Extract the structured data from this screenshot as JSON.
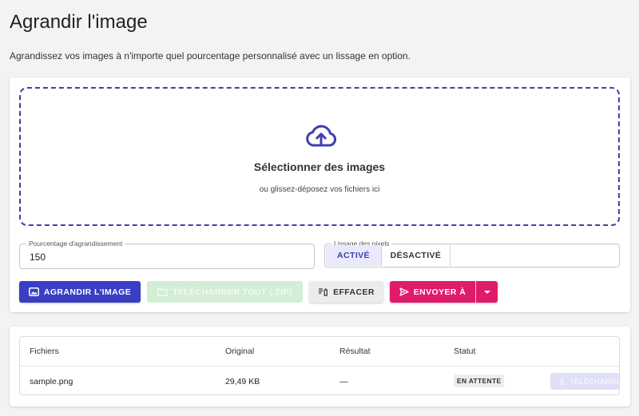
{
  "page": {
    "title": "Agrandir l'image",
    "subtitle": "Agrandissez vos images à n'importe quel pourcentage personnalisé avec un lissage en option."
  },
  "dropzone": {
    "icon": "cloud-upload-icon",
    "title": "Sélectionner des images",
    "subtitle": "ou glissez-déposez vos fichiers ici"
  },
  "options": {
    "percent_label": "Pourcentage d'agrandissement",
    "percent_value": "150",
    "smoothing_label": "Lissage des pixels",
    "smoothing_on": "ACTIVÉ",
    "smoothing_off": "DÉSACTIVÉ",
    "smoothing_selected": "ACTIVÉ"
  },
  "actions": {
    "enlarge": "AGRANDIR L'IMAGE",
    "download_all": "TÉLÉCHARGER TOUT (.ZIP)",
    "clear": "EFFACER",
    "send_to": "ENVOYER À"
  },
  "table": {
    "headers": [
      "Fichiers",
      "Original",
      "Résultat",
      "Statut"
    ],
    "rows": [
      {
        "file": "sample.png",
        "original": "29,49 KB",
        "result": "—",
        "status": "EN ATTENTE",
        "download": "TÉLÉCHARGER"
      }
    ]
  },
  "colors": {
    "primary": "#3a3ec4",
    "accent": "#e01b6b",
    "download_disabled": "#d3eed4"
  }
}
